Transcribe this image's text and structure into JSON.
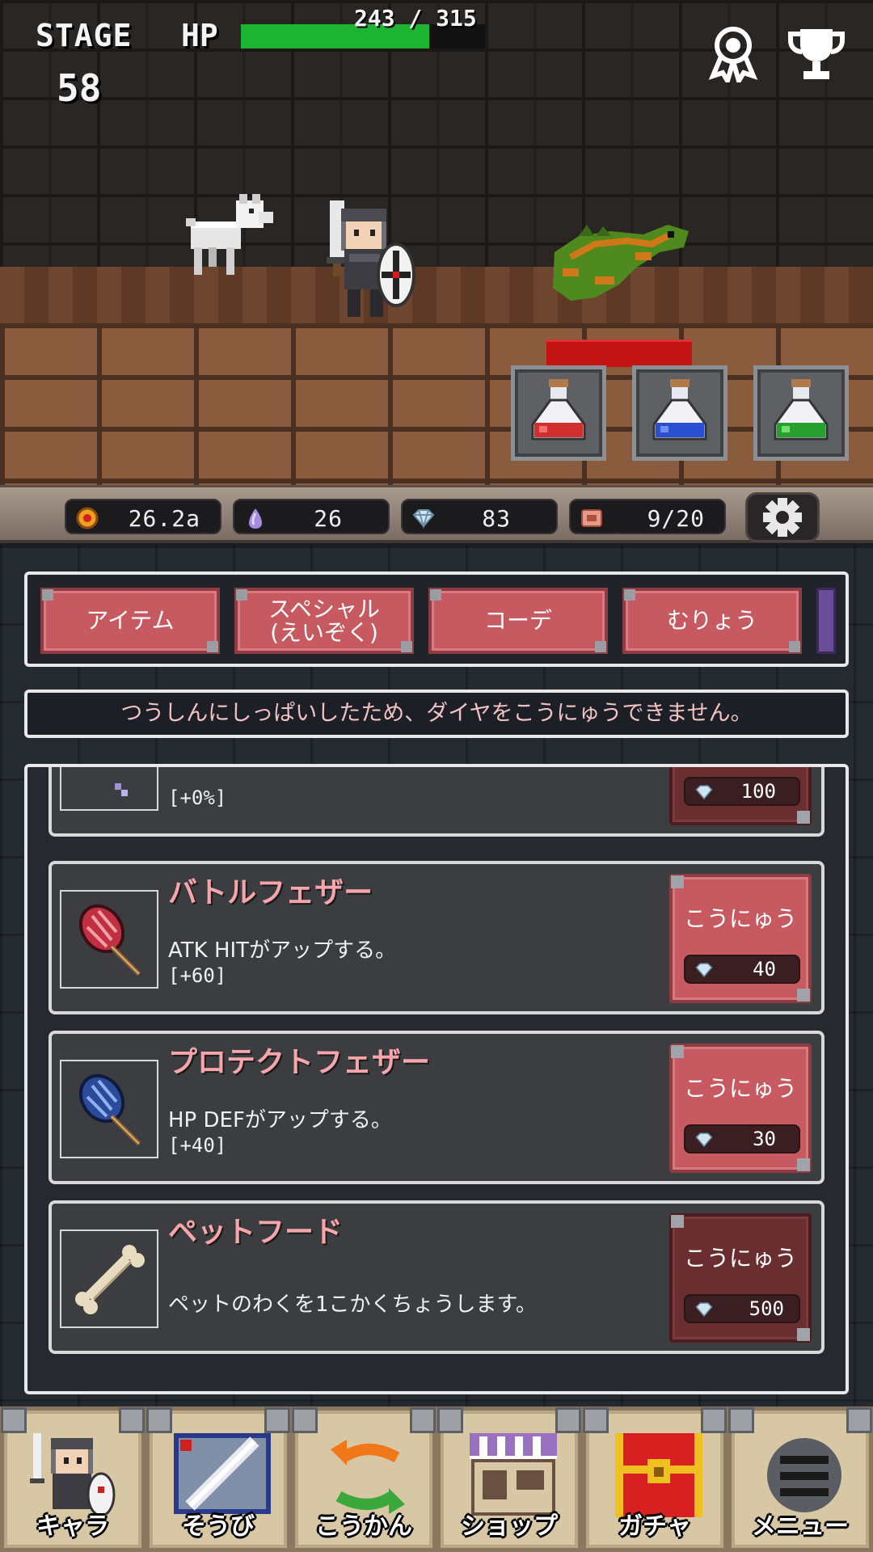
{
  "hud": {
    "stage_label": "STAGE",
    "stage_number": "58",
    "hp_label": "HP",
    "hp_text": "243 / 315",
    "hp_fraction": 0.771
  },
  "currency": {
    "gold": "26.2a",
    "soul": "26",
    "diamond": "83",
    "ticket": "9/20"
  },
  "tabs": [
    {
      "label": "アイテム"
    },
    {
      "label": "スペシャル\n(えいぞく)"
    },
    {
      "label": "コーデ"
    },
    {
      "label": "むりょう"
    }
  ],
  "notice": "つうしんにしっぱいしたため、ダイヤをこうにゅうできません。",
  "items": [
    {
      "name": "",
      "desc": "",
      "bonus": "[+0%]",
      "buy_label": "",
      "price": "100"
    },
    {
      "name": "バトルフェザー",
      "desc": "ATK HITがアップする。",
      "bonus": "[+60]",
      "buy_label": "こうにゅう",
      "price": "40"
    },
    {
      "name": "プロテクトフェザー",
      "desc": "HP DEFがアップする。",
      "bonus": "[+40]",
      "buy_label": "こうにゅう",
      "price": "30"
    },
    {
      "name": "ペットフード",
      "desc": "ペットのわくを1こかくちょうします。",
      "bonus": "",
      "buy_label": "こうにゅう",
      "price": "500"
    }
  ],
  "nav": [
    {
      "label": "キャラ",
      "icon": "knight-icon"
    },
    {
      "label": "そうび",
      "icon": "sword-icon"
    },
    {
      "label": "こうかん",
      "icon": "exchange-icon"
    },
    {
      "label": "ショップ",
      "icon": "shop-icon"
    },
    {
      "label": "ガチャ",
      "icon": "chest-icon"
    },
    {
      "label": "メニュー",
      "icon": "menu-icon"
    }
  ],
  "colors": {
    "hp_green": "#1db432",
    "enemy_hp_red": "#c31414",
    "button_red": "#c75a61",
    "item_name_pink": "#f6a5aa"
  }
}
